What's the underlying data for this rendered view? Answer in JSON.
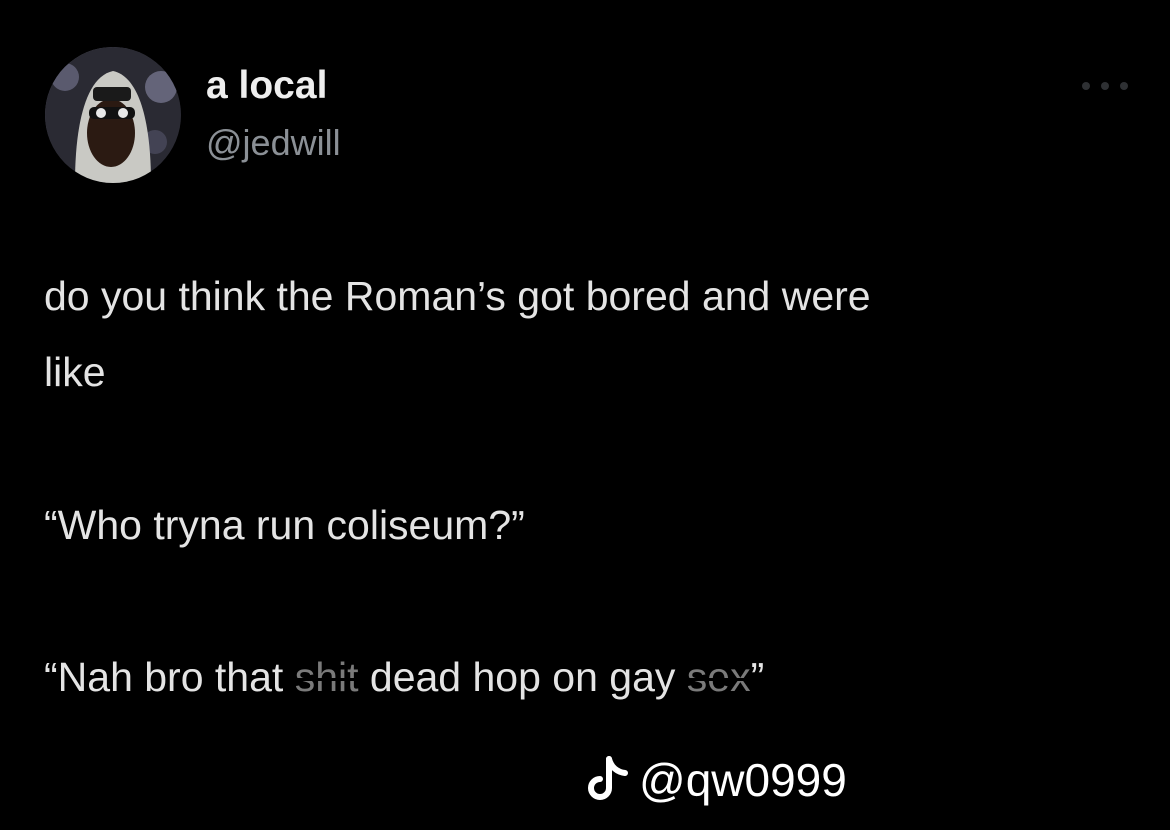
{
  "tweet": {
    "author": {
      "display_name": "a local",
      "handle": "@jedwill",
      "avatar_icon": "avatar-photo-icon"
    },
    "more_icon": "more-horizontal-icon",
    "lines": [
      "do you think the Roman’s got bored and were",
      "like",
      "“Who tryna run coliseum?”",
      "“Nah bro that shit dead hop on gay sex”"
    ],
    "line4_parts": {
      "prefix": "“Nah bro that ",
      "censored_1": "shit",
      "middle": " dead hop on gay ",
      "censored_2": "sex",
      "suffix": "”"
    }
  },
  "watermark": {
    "icon": "tiktok-logo-icon",
    "text": "@qw0999"
  },
  "colors": {
    "background": "#000000",
    "text": "#e4e4e4",
    "handle": "#8b9096"
  }
}
